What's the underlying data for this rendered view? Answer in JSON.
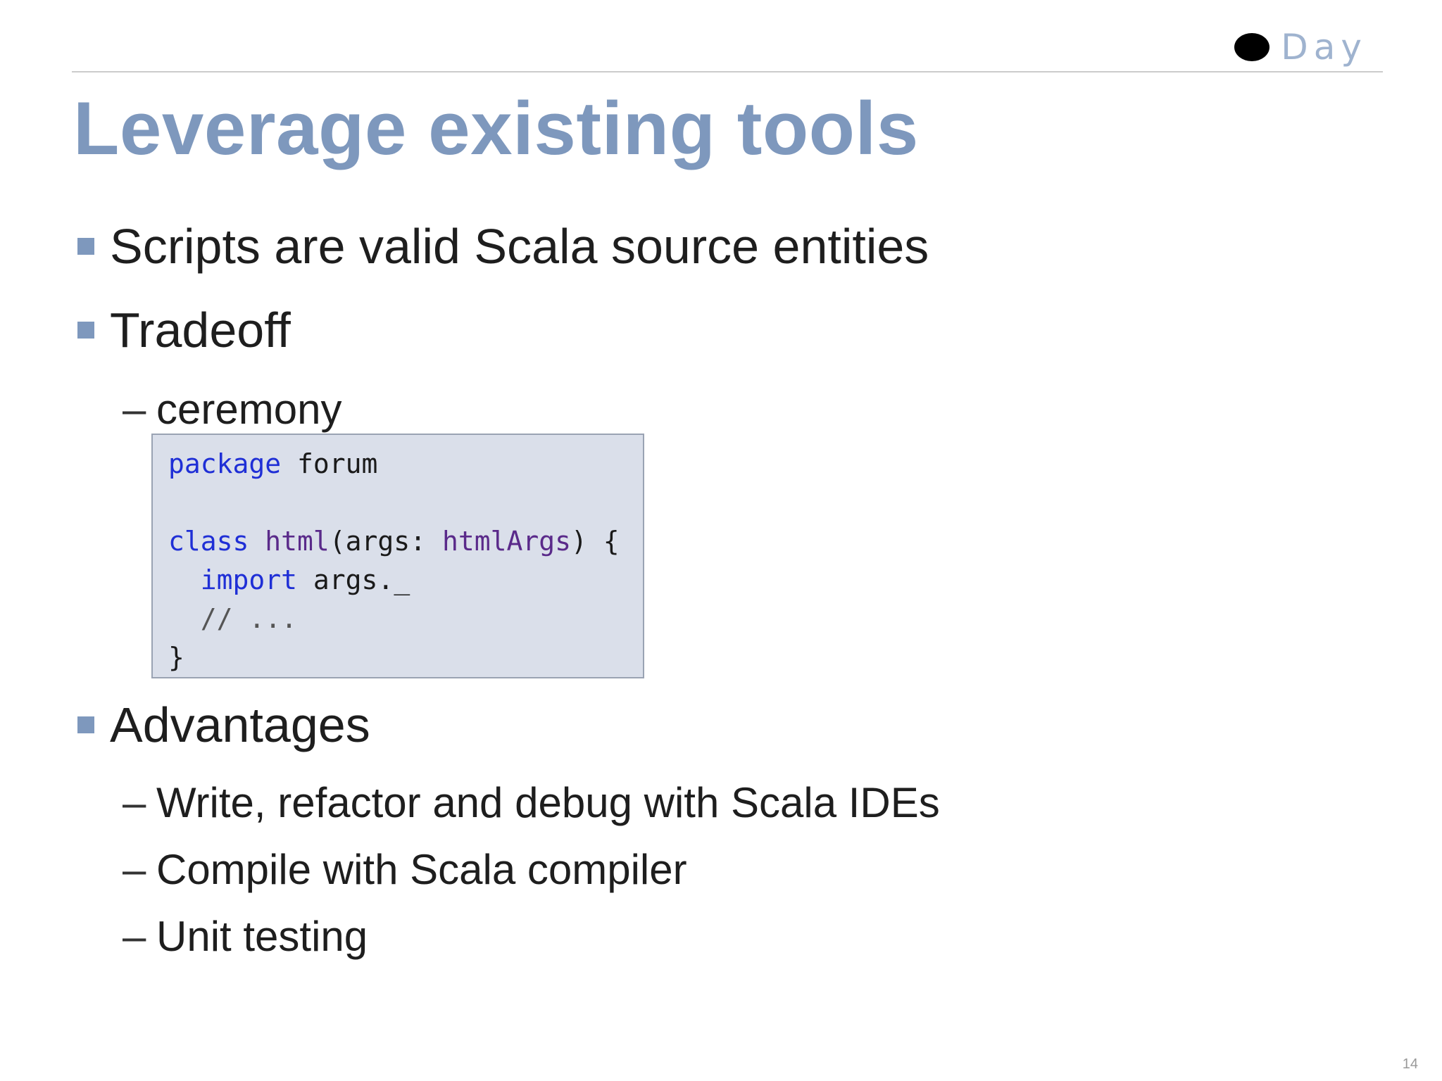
{
  "logo": {
    "text": "Day"
  },
  "slide": {
    "title": "Leverage existing tools",
    "bullets": [
      {
        "text": "Scripts are valid Scala source entities"
      },
      {
        "text": "Tradeoff"
      },
      {
        "text": "Advantages"
      }
    ],
    "tradeoff_sub": "ceremony",
    "advantages_sub": [
      "Write, refactor and debug with Scala IDEs",
      "Compile with Scala compiler",
      "Unit testing"
    ],
    "page_number": "14"
  },
  "code": {
    "line1_kw": "package",
    "line1_rest": " forum",
    "line3_kw": "class",
    "line3_name": " html",
    "line3_paren": "(args: ",
    "line3_type": "htmlArgs",
    "line3_end": ") {",
    "line4_indent": "  ",
    "line4_kw": "import",
    "line4_rest": " args._",
    "line5_comment": "  // ...",
    "line6": "}"
  },
  "colors": {
    "accent": "#7e98bd",
    "code_bg": "#dadfea",
    "keyword": "#1f2fd6",
    "type": "#5a2a8a"
  }
}
